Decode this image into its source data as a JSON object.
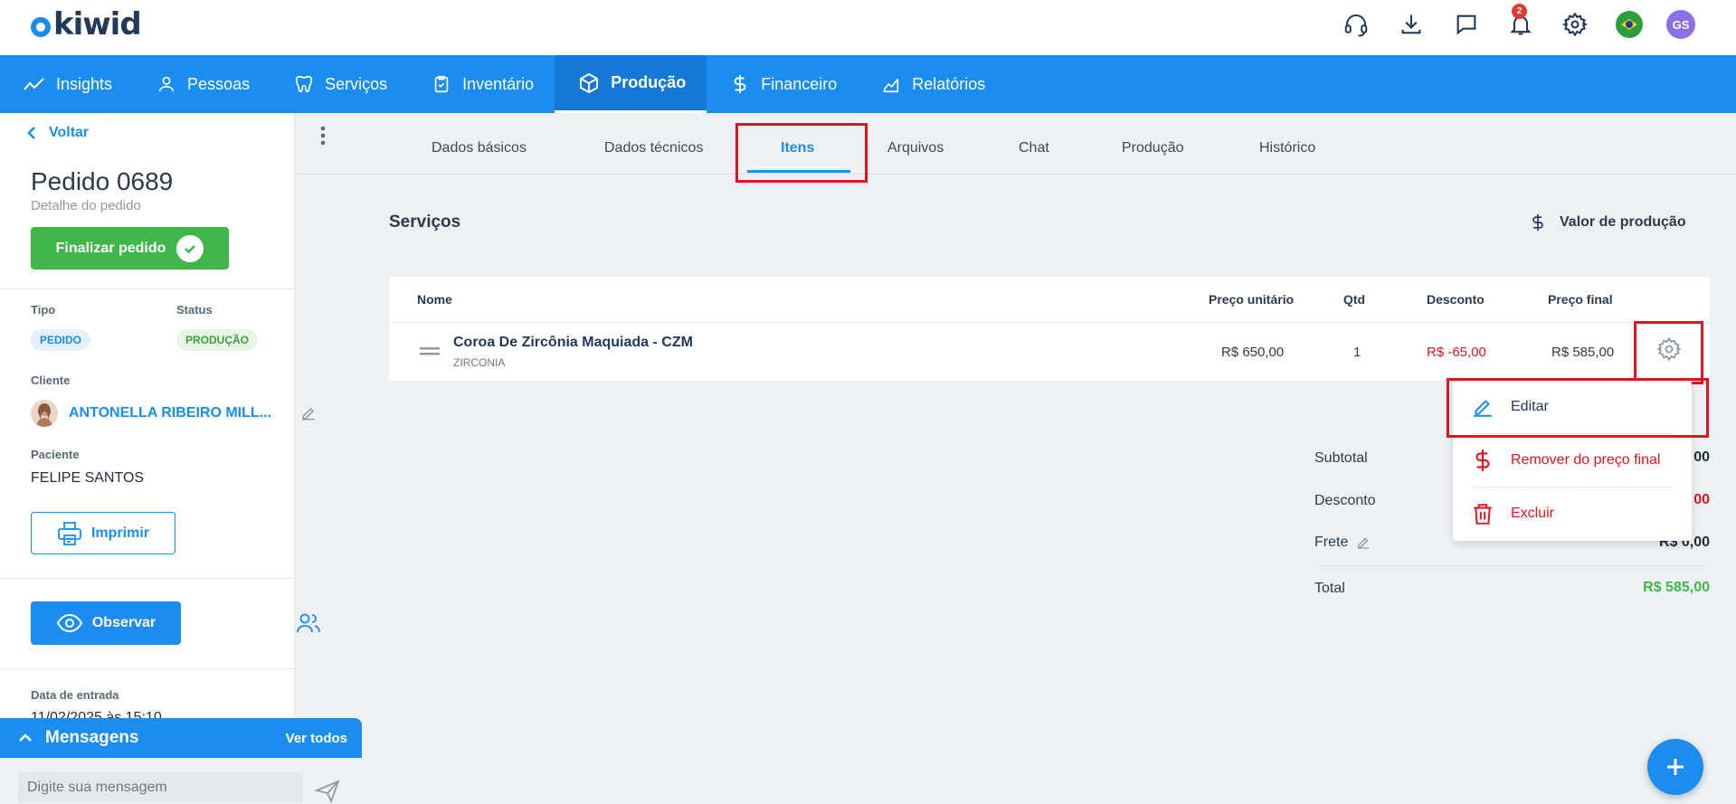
{
  "app": {
    "logo_text": "kiwid"
  },
  "topbar": {
    "notification_count": "2",
    "avatar_initials": "GS"
  },
  "nav": {
    "items": [
      {
        "label": "Insights",
        "icon": "trend-icon"
      },
      {
        "label": "Pessoas",
        "icon": "person-icon"
      },
      {
        "label": "Serviços",
        "icon": "tooth-icon"
      },
      {
        "label": "Inventário",
        "icon": "clipboard-icon"
      },
      {
        "label": "Produção",
        "icon": "box-icon",
        "active": true
      },
      {
        "label": "Financeiro",
        "icon": "dollar-icon"
      },
      {
        "label": "Relatórios",
        "icon": "chart-icon"
      }
    ]
  },
  "sidebar": {
    "back_label": "Voltar",
    "order_title": "Pedido 0689",
    "order_subtitle": "Detalhe do pedido",
    "finalize_label": "Finalizar pedido",
    "tipo_label": "Tipo",
    "tipo_value": "PEDIDO",
    "status_label": "Status",
    "status_value": "PRODUÇÃO",
    "cliente_label": "Cliente",
    "cliente_value": "ANTONELLA RIBEIRO MILL...",
    "paciente_label": "Paciente",
    "paciente_value": "FELIPE SANTOS",
    "print_label": "Imprimir",
    "observe_label": "Observar",
    "entry_label": "Data de entrada",
    "entry_value": "11/02/2025 às 15:10"
  },
  "messages": {
    "title": "Mensagens",
    "see_all": "Ver todos",
    "input_placeholder": "Digite sua mensagem"
  },
  "tabs": [
    {
      "label": "Dados básicos"
    },
    {
      "label": "Dados técnicos"
    },
    {
      "label": "Itens",
      "active": true
    },
    {
      "label": "Arquivos"
    },
    {
      "label": "Chat"
    },
    {
      "label": "Produção"
    },
    {
      "label": "Histórico"
    }
  ],
  "services": {
    "title": "Serviços",
    "production_value_label": "Valor de produção",
    "columns": {
      "name": "Nome",
      "unit_price": "Preço unitário",
      "qty": "Qtd",
      "discount": "Desconto",
      "final_price": "Preço final"
    },
    "rows": [
      {
        "name": "Coroa De Zircônia Maquiada - CZM",
        "material": "ZIRCONIA",
        "unit_price": "R$ 650,00",
        "qty": "1",
        "discount": "R$ -65,00",
        "final_price": "R$ 585,00"
      }
    ]
  },
  "totals": {
    "subtotal_label": "Subtotal",
    "subtotal_value": "00",
    "discount_label": "Desconto",
    "discount_value": "00",
    "freight_label": "Frete",
    "freight_value": "R$ 0,00",
    "total_label": "Total",
    "total_value": "R$ 585,00"
  },
  "row_menu": {
    "items": [
      {
        "label": "Editar"
      },
      {
        "label": "Remover do preço final"
      },
      {
        "label": "Excluir"
      }
    ]
  },
  "colors": {
    "primary": "#1b8cf0",
    "success": "#3fb54a",
    "danger": "#e0141e",
    "highlight_box": "#e0141e"
  }
}
